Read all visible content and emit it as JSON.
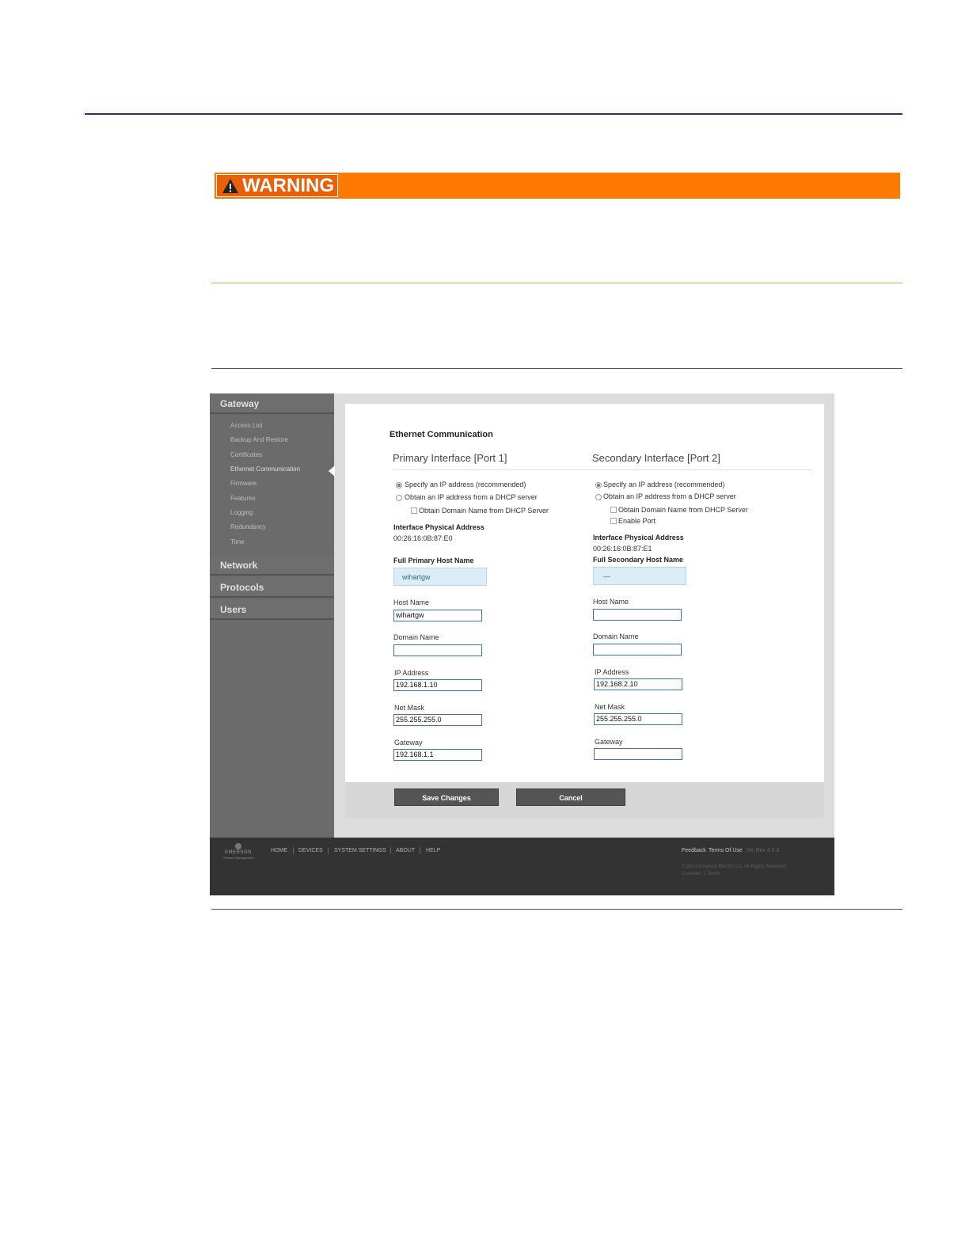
{
  "warning": {
    "label": "WARNING"
  },
  "sidebar": {
    "sections": [
      {
        "label": "Gateway"
      },
      {
        "label": "Network"
      },
      {
        "label": "Protocols"
      },
      {
        "label": "Users"
      }
    ],
    "gateway_items": [
      "Access List",
      "Backup And Restore",
      "Certificates",
      "Ethernet Communication",
      "Firmware",
      "Features",
      "Logging",
      "Redundancy",
      "Time"
    ],
    "active_item": "Ethernet Communication"
  },
  "main": {
    "title": "Ethernet Communication",
    "primary": {
      "heading": "Primary Interface [Port 1]",
      "radio_specify": "Specify an IP address (recommended)",
      "radio_dhcp": "Obtain an IP address from a DHCP server",
      "check_domain": "Obtain Domain Name from DHCP Server",
      "phys_label": "Interface Physical Address",
      "phys_value": "00:26:16:0B:87:E0",
      "full_host_label": "Full Primary Host Name",
      "full_host_value": "wihartgw",
      "host_label": "Host Name",
      "host_value": "wihartgw",
      "domain_label": "Domain Name",
      "domain_value": "",
      "ip_label": "IP Address",
      "ip_value": "192.168.1.10",
      "mask_label": "Net Mask",
      "mask_value": "255.255.255.0",
      "gateway_label": "Gateway",
      "gateway_value": "192.168.1.1"
    },
    "secondary": {
      "heading": "Secondary Interface [Port 2]",
      "radio_specify": "Specify an IP address (recommended)",
      "radio_dhcp": "Obtain an IP address from a DHCP server",
      "check_domain": "Obtain Domain Name from DHCP Server",
      "check_enable": "Enable Port",
      "phys_label": "Interface Physical Address",
      "phys_value": "00:26:16:0B:87:E1",
      "full_host_label": "Full Secondary Host Name",
      "full_host_value": "—",
      "host_label": "Host Name",
      "host_value": "",
      "domain_label": "Domain Name",
      "domain_value": "",
      "ip_label": "IP Address",
      "ip_value": "192.168.2.10",
      "mask_label": "Net Mask",
      "mask_value": "255.255.255.0",
      "gateway_label": "Gateway",
      "gateway_value": ""
    },
    "save_label": "Save Changes",
    "cancel_label": "Cancel"
  },
  "footer": {
    "brand": "EMERSON",
    "brand_sub": "Process Management",
    "nav": [
      "HOME",
      "DEVICES",
      "SYSTEM SETTINGS",
      "ABOUT",
      "HELP"
    ],
    "feedback": "Feedback",
    "terms": "Terms Of Use",
    "version": "Ver Rev 4.5.0",
    "copyright": "© 2013 Emerson Electric Co. All Rights Reserved.",
    "license": "Consider: 1 Ser/er"
  },
  "colors": {
    "warning_orange": "#ff7a00",
    "rule_navy": "#1f3864",
    "rule_orange": "#e8a05a",
    "input_border": "#3f6fb5"
  }
}
